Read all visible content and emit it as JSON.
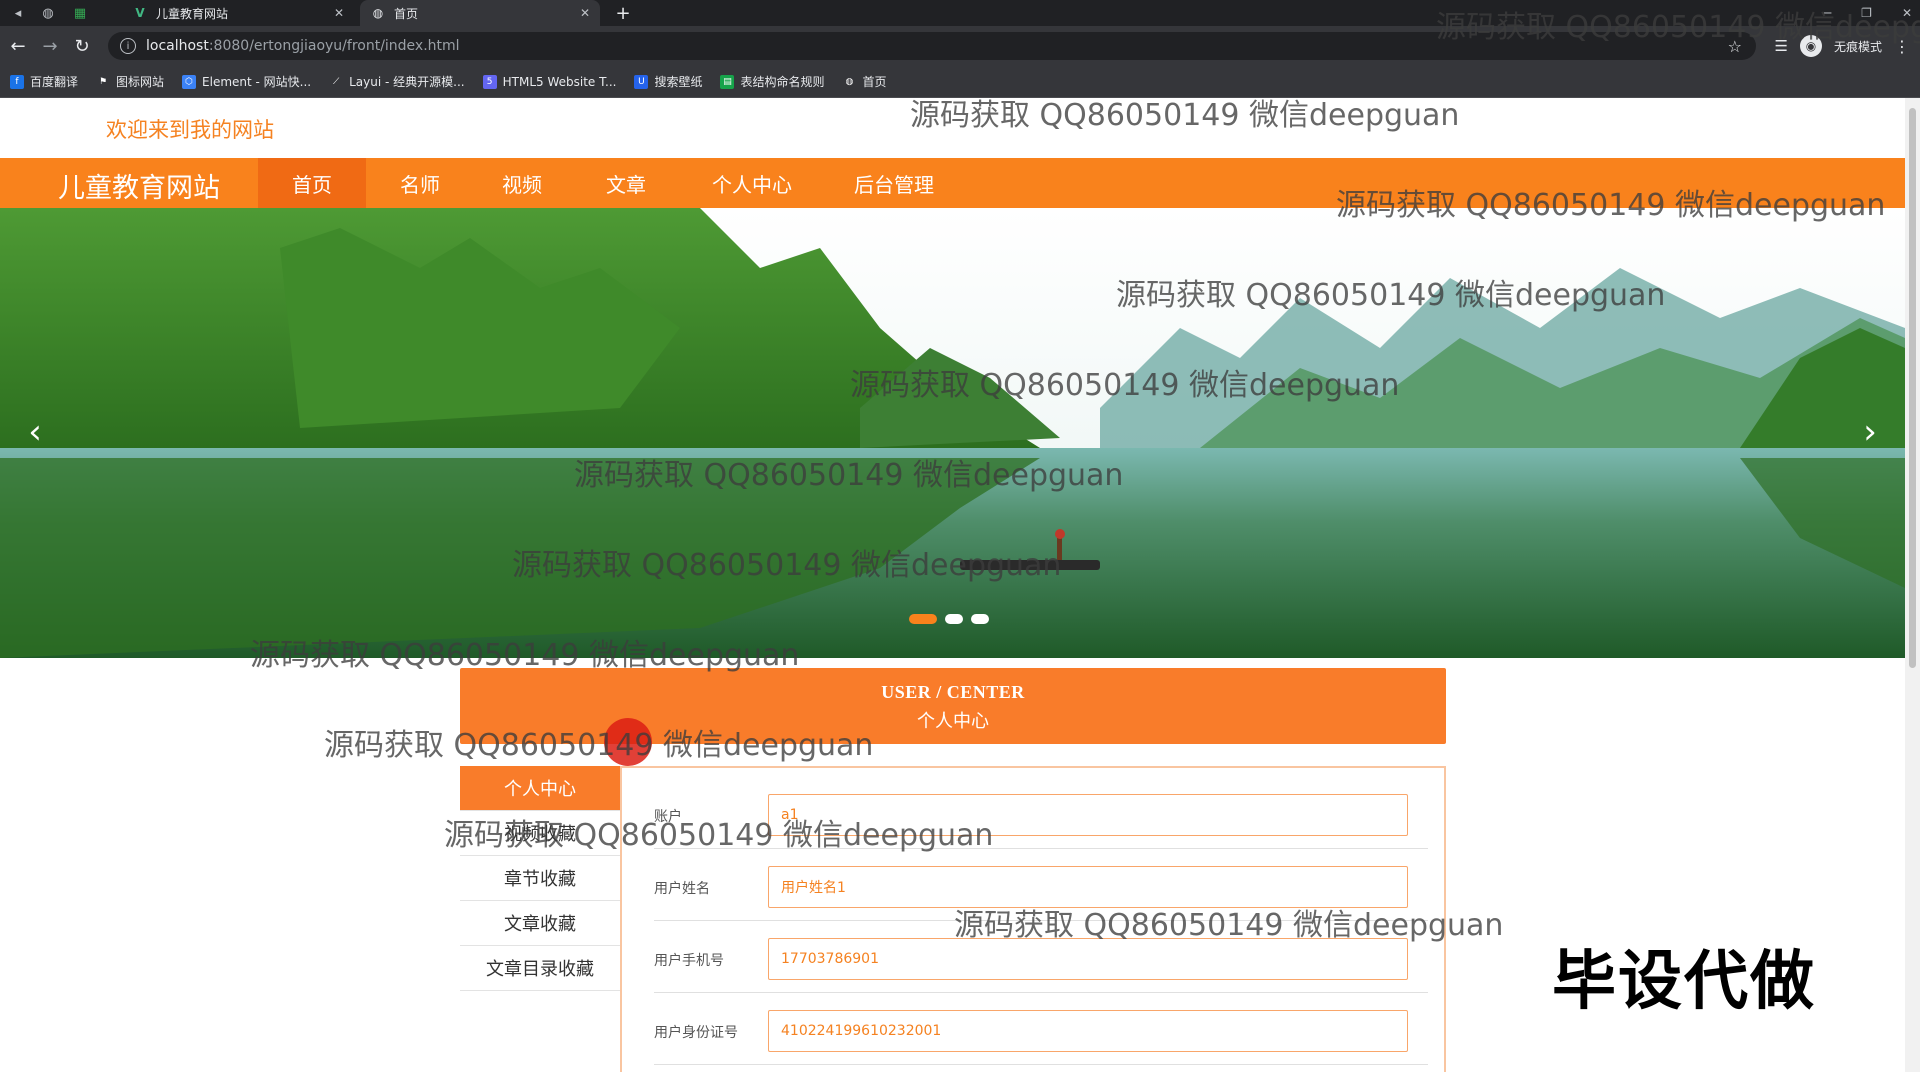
{
  "browser": {
    "tabs": [
      {
        "title": "儿童教育网站",
        "active": false
      },
      {
        "title": "首页",
        "active": true
      }
    ],
    "new_tab": "+",
    "url_host": "localhost",
    "url_path": ":8080/ertongjiaoyu/front/index.html",
    "incognito_label": "无痕模式",
    "bookmarks": [
      "百度翻译",
      "图标网站",
      "Element - 网站快...",
      "Layui - 经典开源模...",
      "HTML5 Website T...",
      "搜索壁纸",
      "表结构命名规则",
      "首页"
    ],
    "colors": {
      "bookmark_icons": [
        "#1a73e8",
        "#ffffff",
        "#3b82f6",
        "#ffffff",
        "#6366f1",
        "#2563eb",
        "#16a34a",
        "#ffffff"
      ]
    }
  },
  "site": {
    "welcome": "欢迎来到我的网站",
    "title": "儿童教育网站",
    "nav": [
      "首页",
      "名师",
      "视频",
      "文章",
      "个人中心",
      "后台管理"
    ],
    "active_nav": "首页",
    "accent_color": "#f9821c"
  },
  "carousel": {
    "slides": 3,
    "active_slide": 1
  },
  "user_center": {
    "header_en": "USER / CENTER",
    "header_cn": "个人中心",
    "menu": [
      "个人中心",
      "视频收藏",
      "章节收藏",
      "文章收藏",
      "文章目录收藏"
    ],
    "active_menu": "个人中心"
  },
  "form": {
    "fields": [
      {
        "label": "账户",
        "value": "a1"
      },
      {
        "label": "用户姓名",
        "value": "用户姓名1"
      },
      {
        "label": "用户手机号",
        "value": "17703786901"
      },
      {
        "label": "用户身份证号",
        "value": "410224199610232001"
      }
    ]
  },
  "watermark": "源码获取 QQ86050149 微信deepguan",
  "overlay_text": "毕设代做",
  "icons": [
    "back-arrow-icon",
    "forward-arrow-icon",
    "reload-icon",
    "info-icon",
    "star-icon",
    "reading-list-icon",
    "incognito-icon",
    "more-icon",
    "chevron-left-icon",
    "chevron-right-icon"
  ]
}
